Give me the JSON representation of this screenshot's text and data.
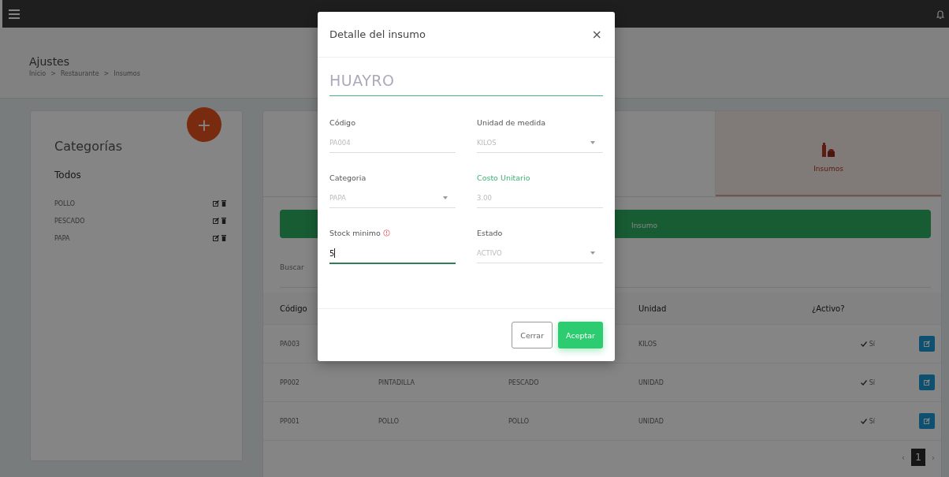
{
  "header": {
    "title": "Ajustes",
    "breadcrumbs": [
      "Inicio",
      "Restaurante",
      "Insumos"
    ],
    "separator": ">"
  },
  "categories": {
    "title": "Categorías",
    "all": "Todos",
    "items": [
      {
        "name": "POLLO"
      },
      {
        "name": "PESCADO"
      },
      {
        "name": "PAPA"
      }
    ]
  },
  "fab": {
    "label": "+"
  },
  "tabs": [
    {
      "selected": false
    },
    {
      "label": "Insumos",
      "selected": true
    }
  ],
  "new_button": {
    "label": "Insumo"
  },
  "search": {
    "label": "Buscar"
  },
  "table": {
    "columns": [
      {
        "label": "Código"
      },
      {},
      {},
      {
        "label": "Unidad"
      },
      {
        "label": "¿Activo?"
      }
    ],
    "rows": [
      {
        "cells": [
          "PA003",
          null,
          null,
          "KILOS"
        ],
        "active": true,
        "active_label": "Sí"
      },
      {
        "cells": [
          "PP002",
          "PINTADILLA",
          "PESCADO",
          "UNIDAD"
        ],
        "active": true,
        "active_label": "Sí"
      },
      {
        "cells": [
          "PP001",
          "POLLO",
          "POLLO",
          "UNIDAD"
        ],
        "active": true,
        "active_label": "Sí"
      }
    ]
  },
  "pagination": {
    "prev": "‹",
    "next": "›",
    "pages": [
      {
        "label": "1",
        "selected": true
      }
    ]
  },
  "modal": {
    "title": "Detalle del insumo",
    "close": "×",
    "name": "HUAYRO",
    "fields": [
      {
        "label": "Código",
        "value": "PA004",
        "kind": "text",
        "valid": false,
        "focused": false,
        "required": false
      },
      {
        "label": "Unidad de medida",
        "value": "KILOS",
        "kind": "select",
        "valid": false,
        "focused": false,
        "required": false
      },
      {
        "label": "Categoria",
        "value": "PAPA",
        "kind": "select",
        "valid": false,
        "focused": false,
        "required": false
      },
      {
        "label": "Costo Unitario",
        "value": "3.00",
        "kind": "text",
        "valid": true,
        "focused": false,
        "required": false
      },
      {
        "label": "Stock minimo",
        "value": "5",
        "kind": "text",
        "valid": false,
        "focused": true,
        "required": true
      },
      {
        "label": "Estado",
        "value": "ACTIVO",
        "kind": "select",
        "valid": false,
        "focused": false,
        "required": false
      }
    ],
    "buttons": [
      {
        "label": "Cerrar",
        "kind": "secondary"
      },
      {
        "label": "Aceptar",
        "kind": "primary"
      }
    ]
  }
}
